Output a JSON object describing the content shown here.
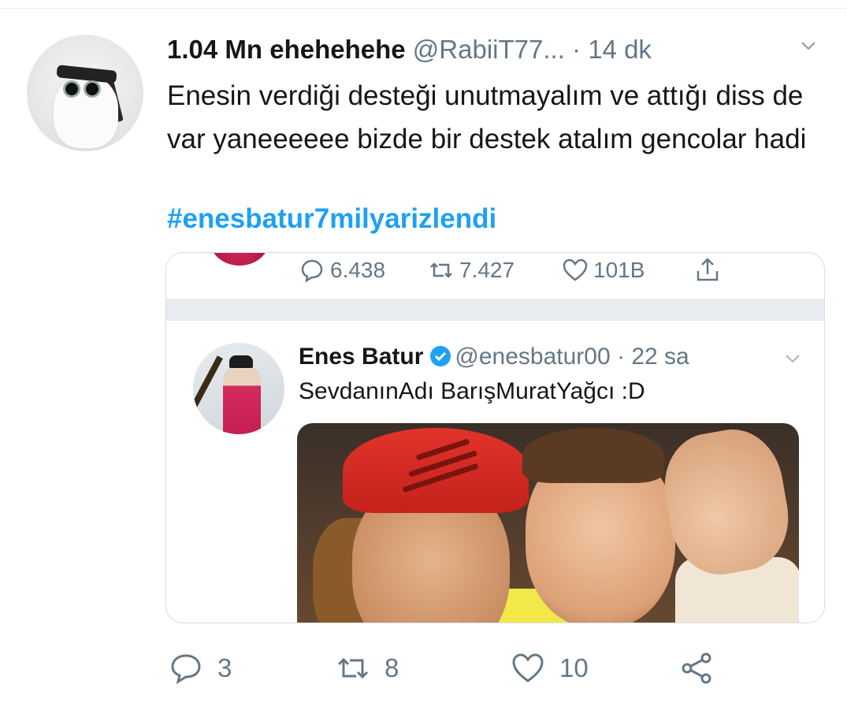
{
  "tweet": {
    "display_name": "1.04 Mn ehehehehe",
    "handle": "@RabiiT77...",
    "separator": "·",
    "time": "14 dk",
    "text": "Enesin verdiği desteği unutmayalım ve attığı diss de var yaneeeeee bizde bir destek atalım gencolar hadi",
    "hashtag": "#enesbatur7milyarizlendi",
    "avatar_icon": "cat-with-sunglasses-avatar",
    "caret_icon": "chevron-down-icon"
  },
  "quoted": {
    "prev_actions": {
      "reply_count": "6.438",
      "retweet_count": "7.427",
      "like_count": "101B"
    },
    "display_name": "Enes Batur",
    "verified_icon": "verified-badge-icon",
    "handle": "@enesbatur00",
    "separator": "·",
    "time": "22 sa",
    "text": "SevdanınAdı BarışMuratYağcı :D",
    "photo": "selfie-photo"
  },
  "actions": {
    "reply_count": "3",
    "retweet_count": "8",
    "like_count": "10",
    "icons": [
      "reply-icon",
      "retweet-icon",
      "like-icon",
      "share-icon"
    ]
  },
  "colors": {
    "link": "#1da1f2",
    "muted": "#657786",
    "text": "#14171a",
    "verified": "#1da1f2"
  }
}
